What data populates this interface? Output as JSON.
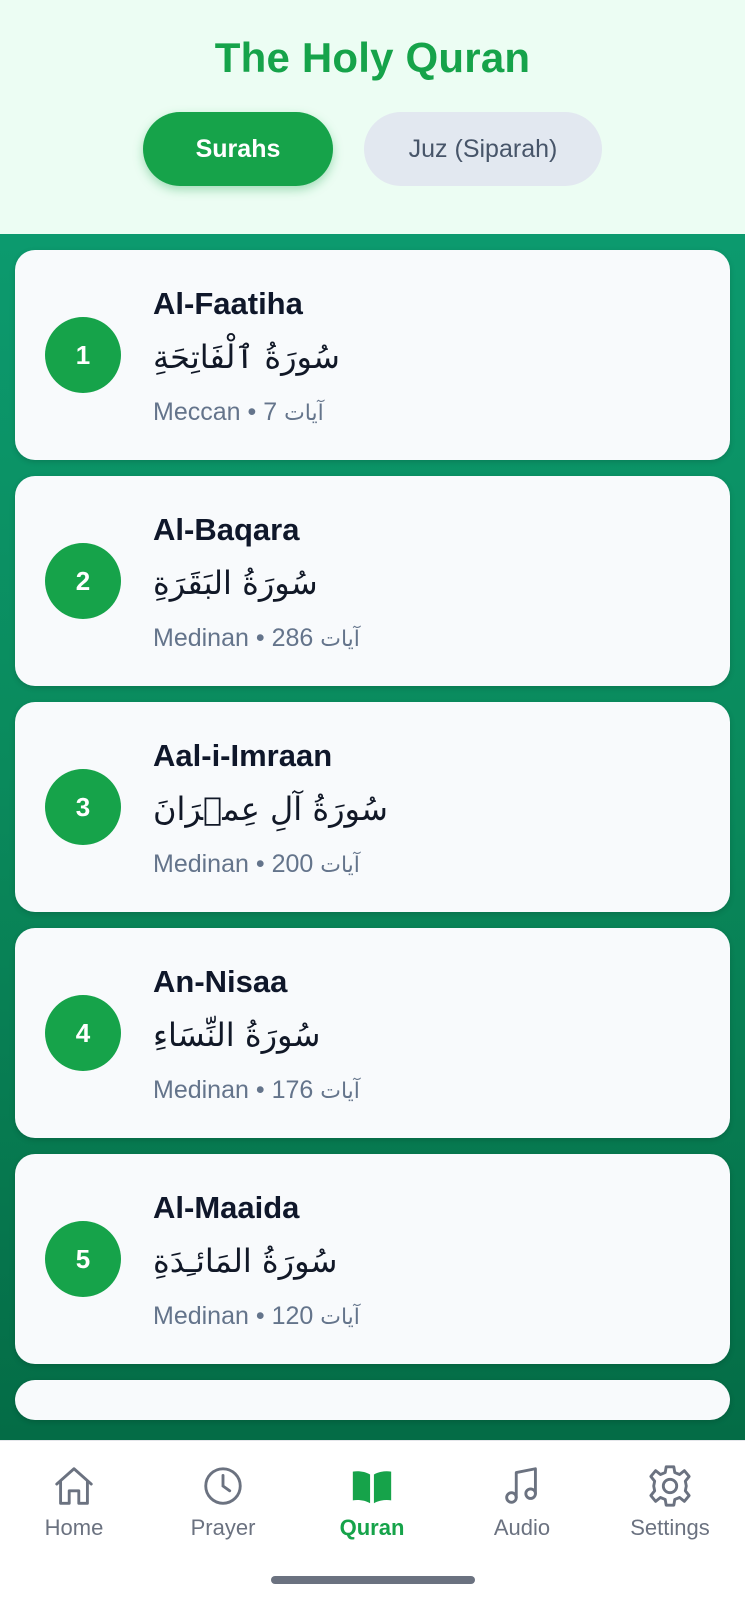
{
  "header": {
    "title": "The Holy Quran",
    "tabs": [
      {
        "label": "Surahs",
        "active": true
      },
      {
        "label": "Juz (Siparah)",
        "active": false
      }
    ]
  },
  "surahs": [
    {
      "number": "1",
      "name": "Al-Faatiha",
      "arabic": "سُورَةُ ٱلْفَاتِحَةِ",
      "type": "Meccan",
      "ayat_count": "7",
      "ayat_word": "آيات"
    },
    {
      "number": "2",
      "name": "Al-Baqara",
      "arabic": "سُورَةُ البَقَرَةِ",
      "type": "Medinan",
      "ayat_count": "286",
      "ayat_word": "آيات"
    },
    {
      "number": "3",
      "name": "Aal-i-Imraan",
      "arabic": "سُورَةُ آلِ عِمۡرَانَ",
      "type": "Medinan",
      "ayat_count": "200",
      "ayat_word": "آيات"
    },
    {
      "number": "4",
      "name": "An-Nisaa",
      "arabic": "سُورَةُ النِّسَاءِ",
      "type": "Medinan",
      "ayat_count": "176",
      "ayat_word": "آيات"
    },
    {
      "number": "5",
      "name": "Al-Maaida",
      "arabic": "سُورَةُ المَائـِدَةِ",
      "type": "Medinan",
      "ayat_count": "120",
      "ayat_word": "آيات"
    }
  ],
  "separator": "•",
  "bottom_nav": [
    {
      "label": "Home",
      "icon": "home-icon",
      "active": false
    },
    {
      "label": "Prayer",
      "icon": "clock-icon",
      "active": false
    },
    {
      "label": "Quran",
      "icon": "book-icon",
      "active": true
    },
    {
      "label": "Audio",
      "icon": "music-note-icon",
      "active": false
    },
    {
      "label": "Settings",
      "icon": "gear-icon",
      "active": false
    }
  ],
  "colors": {
    "accent": "#16a34a",
    "inactive_tab": "#e2e8f0",
    "list_background": "#0a8a5c"
  }
}
